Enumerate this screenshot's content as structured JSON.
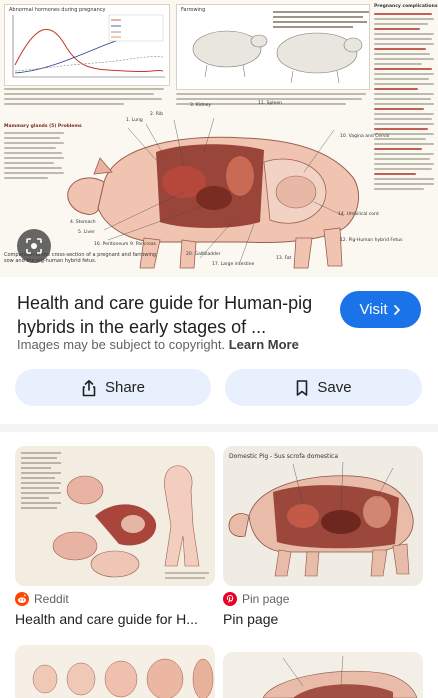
{
  "hero": {
    "chart_title": "Abnormal hormones during pregnancy",
    "farrowing_title": "Farrowing",
    "complications_title": "Pregnancy complications",
    "mammary_title": "Mammary glands (5) Problems",
    "caption": "Comparison of the cross-section of a pregnant and farrowing sow and the pig-human hybrid fetus.",
    "labels": {
      "spleen": "11. Spleen",
      "kidney": "3. Kidney",
      "rib": "2. Rib",
      "lung": "1. Lung",
      "vagina": "10. Vagina and Cervix",
      "stomach": "4. Stomach",
      "liver": "5. Liver",
      "peritoneum": "16. Peritoneum",
      "pancreas": "9. Pancreas",
      "gallbladder": "20. Gallbladder",
      "large_intestine": "17. Large intestine",
      "fat": "13. Fat",
      "umbilical_cord": "14. Umbilical cord",
      "hybrid_fetus": "12. Pig-Human hybrid Fetus"
    }
  },
  "result": {
    "title": "Health and care guide for Human-pig hybrids in the early stages of ...",
    "visit_label": "Visit",
    "copyright_text": "Images may be subject to copyright.",
    "learn_more": "Learn More",
    "share_label": "Share",
    "save_label": "Save"
  },
  "related": [
    {
      "source": "Reddit",
      "title": "Health and care guide for H..."
    },
    {
      "source": "Pin page",
      "title": "Pin page",
      "thumb_title": "Domestic Pig - Sus scrofa domestica"
    }
  ],
  "colors": {
    "accent": "#1a73e8",
    "chip_bg": "#e8f0fe",
    "reddit": "#ff4500",
    "pinterest": "#e60023"
  }
}
